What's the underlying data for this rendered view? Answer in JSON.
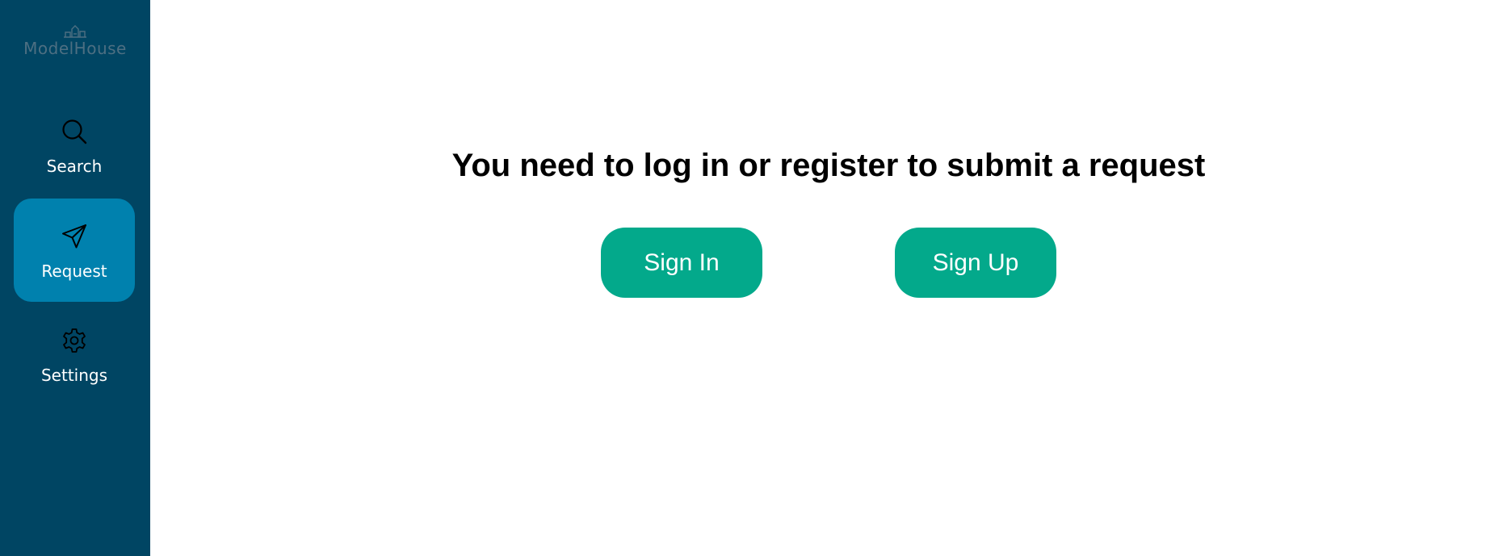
{
  "app": {
    "logo_text": "ModelHouse"
  },
  "sidebar": {
    "items": [
      {
        "label": "Search",
        "icon": "search-icon",
        "active": false
      },
      {
        "label": "Request",
        "icon": "send-icon",
        "active": true
      },
      {
        "label": "Settings",
        "icon": "gear-icon",
        "active": false
      }
    ]
  },
  "main": {
    "heading": "You need to log in or register to submit a request",
    "sign_in_label": "Sign In",
    "sign_up_label": "Sign Up"
  },
  "colors": {
    "sidebar_bg": "#004563",
    "active_item_bg": "#0081ae",
    "button_bg": "#03a98b",
    "logo_text": "#4d6f82"
  }
}
